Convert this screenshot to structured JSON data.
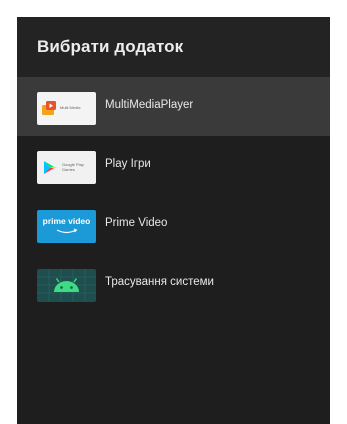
{
  "dialog": {
    "title": "Вибрати додаток"
  },
  "apps": [
    {
      "label": "MultiMediaPlayer",
      "icon": "multimediaplayer-icon",
      "icon_text": "Multi Media",
      "selected": true
    },
    {
      "label": "Play Ігри",
      "icon": "google-play-games-icon",
      "icon_text_1": "Google Play",
      "icon_text_2": "Games",
      "selected": false
    },
    {
      "label": "Prime Video",
      "icon": "prime-video-icon",
      "icon_text": "prime video",
      "selected": false
    },
    {
      "label": "Трасування системи",
      "icon": "system-tracing-android-icon",
      "selected": false
    }
  ],
  "colors": {
    "dialog_bg": "#1e1e1e",
    "header_bg": "#232323",
    "selected_row": "#3a3a3a",
    "prime_blue": "#1b9ad7",
    "android_green": "#3ddc84"
  }
}
